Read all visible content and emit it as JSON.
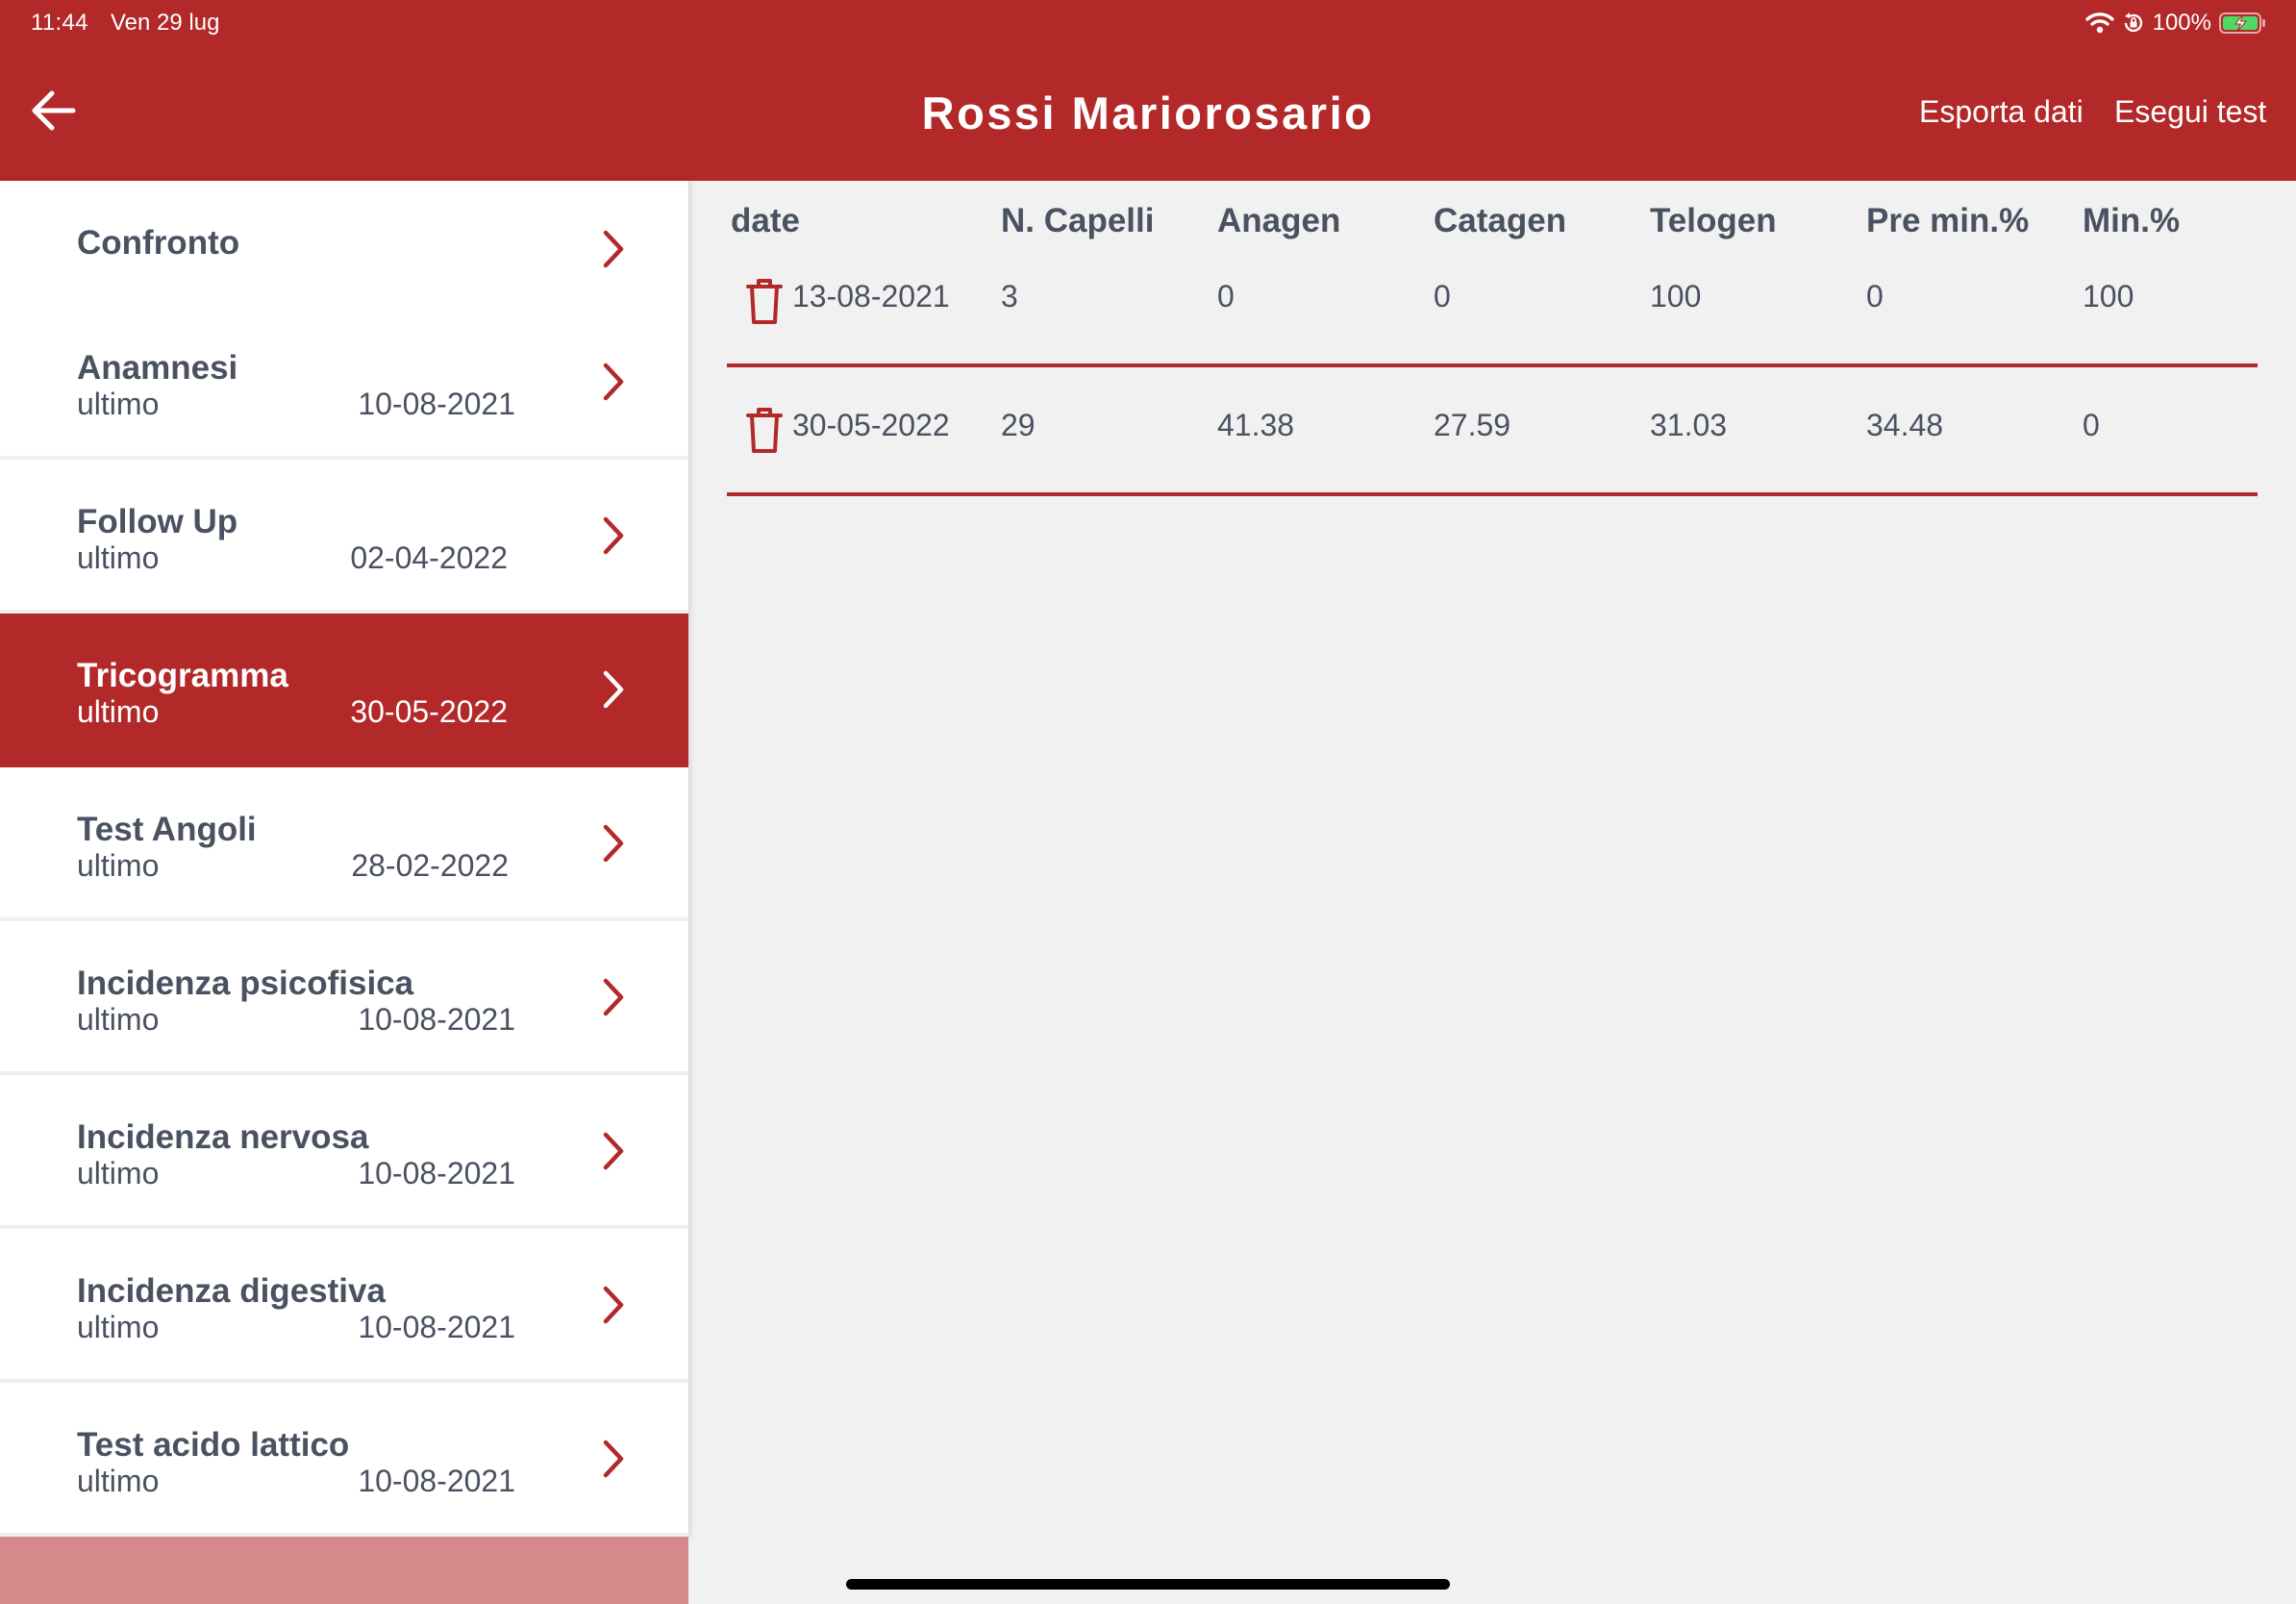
{
  "status_bar": {
    "time": "11:44",
    "date": "Ven 29 lug",
    "battery": "100%"
  },
  "header": {
    "title": "Rossi Mariorosario",
    "export_label": "Esporta dati",
    "run_test_label": "Esegui test"
  },
  "sidebar": {
    "items": [
      {
        "title": "Confronto",
        "sub": "",
        "date": ""
      },
      {
        "title": "Anamnesi",
        "sub": "ultimo",
        "date": "10-08-2021"
      },
      {
        "title": "Follow Up",
        "sub": "ultimo",
        "date": "02-04-2022"
      },
      {
        "title": "Tricogramma",
        "sub": "ultimo",
        "date": "30-05-2022"
      },
      {
        "title": "Test Angoli",
        "sub": "ultimo",
        "date": "28-02-2022"
      },
      {
        "title": "Incidenza psicofisica",
        "sub": "ultimo",
        "date": "10-08-2021"
      },
      {
        "title": "Incidenza nervosa",
        "sub": "ultimo",
        "date": "10-08-2021"
      },
      {
        "title": "Incidenza digestiva",
        "sub": "ultimo",
        "date": "10-08-2021"
      },
      {
        "title": "Test acido lattico",
        "sub": "ultimo",
        "date": "10-08-2021"
      }
    ],
    "active_item": "Tricogramma"
  },
  "table": {
    "columns": [
      "date",
      "N. Capelli",
      "Anagen",
      "Catagen",
      "Telogen",
      "Pre min.%",
      "Min.%"
    ],
    "rows": [
      [
        "13-08-2021",
        "3",
        "0",
        "0",
        "100",
        "0",
        "100"
      ],
      [
        "30-05-2022",
        "29",
        "41.38",
        "27.59",
        "31.03",
        "34.48",
        "0"
      ]
    ]
  },
  "colors": {
    "accent": "#b32828",
    "background": "#f1f1f1",
    "text": "#4a5160"
  }
}
